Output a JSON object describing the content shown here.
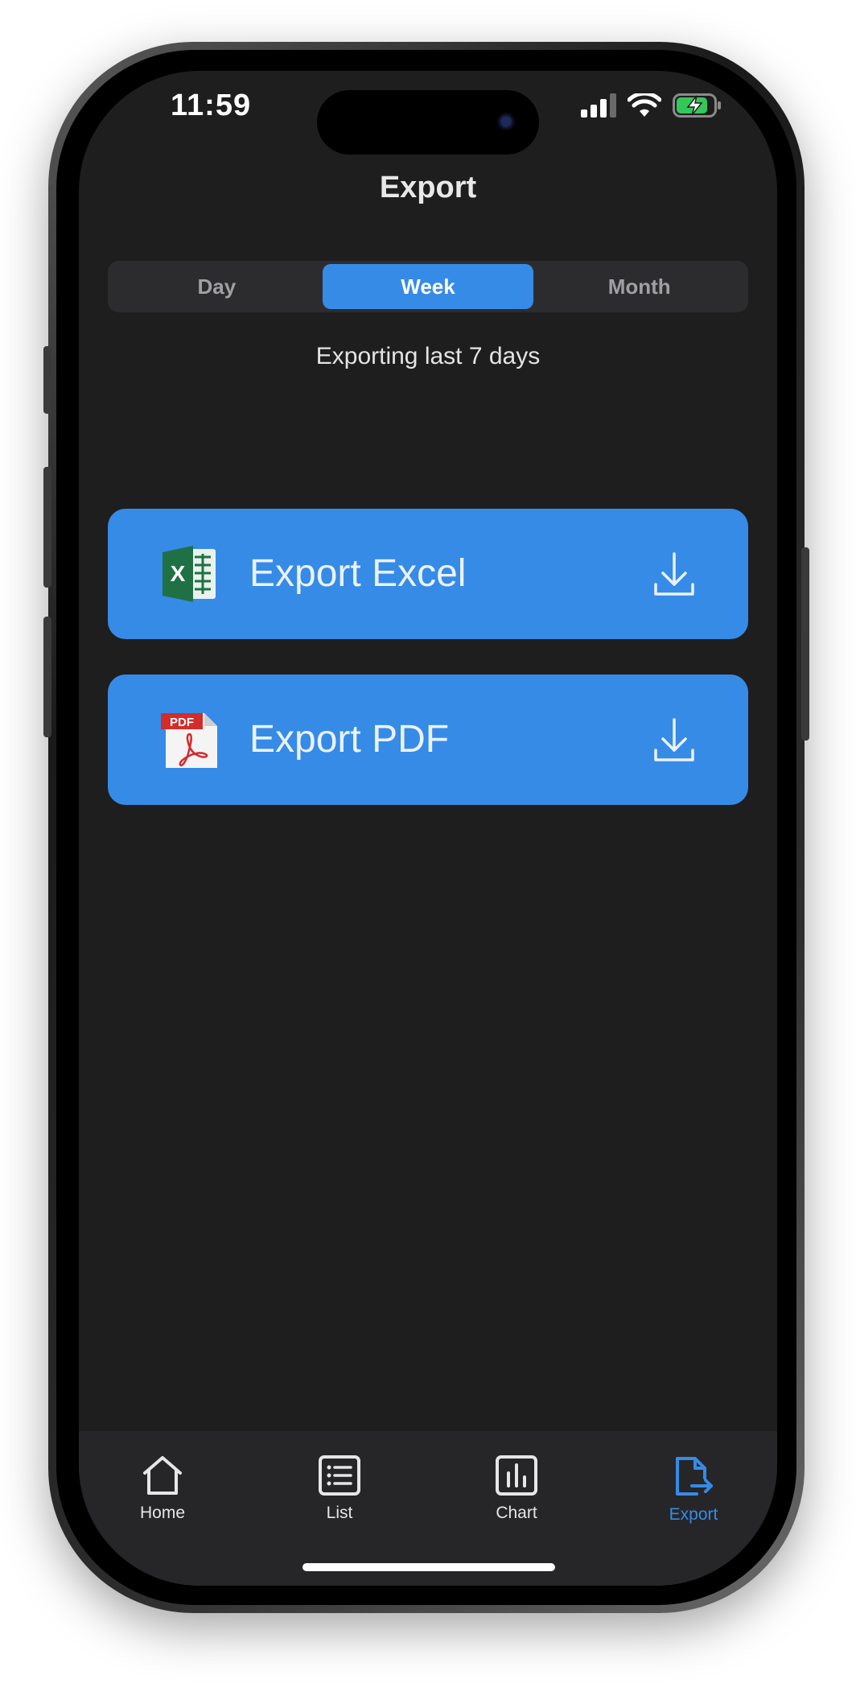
{
  "status_bar": {
    "time": "11:59"
  },
  "header": {
    "title": "Export"
  },
  "range_selector": {
    "options": [
      "Day",
      "Week",
      "Month"
    ],
    "selected": "Week"
  },
  "subtitle": "Exporting last 7 days",
  "export_buttons": [
    {
      "label": "Export Excel",
      "icon": "excel-file-icon"
    },
    {
      "label": "Export PDF",
      "icon": "pdf-file-icon",
      "badge": "PDF"
    }
  ],
  "tab_bar": {
    "items": [
      {
        "label": "Home",
        "icon": "home-icon"
      },
      {
        "label": "List",
        "icon": "list-icon"
      },
      {
        "label": "Chart",
        "icon": "chart-icon"
      },
      {
        "label": "Export",
        "icon": "export-file-icon"
      }
    ],
    "active": "Export"
  },
  "colors": {
    "accent": "#368be6",
    "background": "#1e1e1e",
    "tabbar": "#262628",
    "segment_background": "#2c2c2e",
    "excel_green": "#1f7145",
    "pdf_red": "#d42b2b"
  }
}
